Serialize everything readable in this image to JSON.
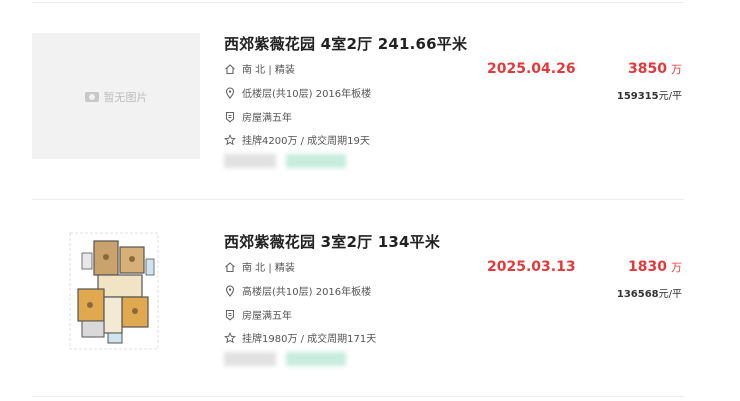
{
  "listings": [
    {
      "title": "西郊紫薇花园 4室2厅 241.66平米",
      "no_image_text": "暂无图片",
      "orientation_deco": "南 北 | 精装",
      "floor_info": "低楼层(共10层) 2016年板楼",
      "tag": "房屋满五年",
      "listing_info": "挂牌4200万 / 成交周期19天",
      "deal_date": "2025.04.26",
      "total_price": "3850",
      "total_price_unit": "万",
      "unit_price_value": "159315",
      "unit_price_suffix": "元/平"
    },
    {
      "title": "西郊紫薇花园 3室2厅 134平米",
      "orientation_deco": "南 北 | 精装",
      "floor_info": "高楼层(共10层) 2016年板楼",
      "tag": "房屋满五年",
      "listing_info": "挂牌1980万 / 成交周期171天",
      "deal_date": "2025.03.13",
      "total_price": "1830",
      "total_price_unit": "万",
      "unit_price_value": "136568",
      "unit_price_suffix": "元/平"
    }
  ],
  "icons": {
    "house": "house-icon",
    "location": "location-pin-icon",
    "tag": "shield-tag-icon",
    "star": "star-icon",
    "camera": "camera-icon"
  },
  "colors": {
    "accent_red": "#e4393c",
    "text": "#333333",
    "muted": "#555555"
  }
}
